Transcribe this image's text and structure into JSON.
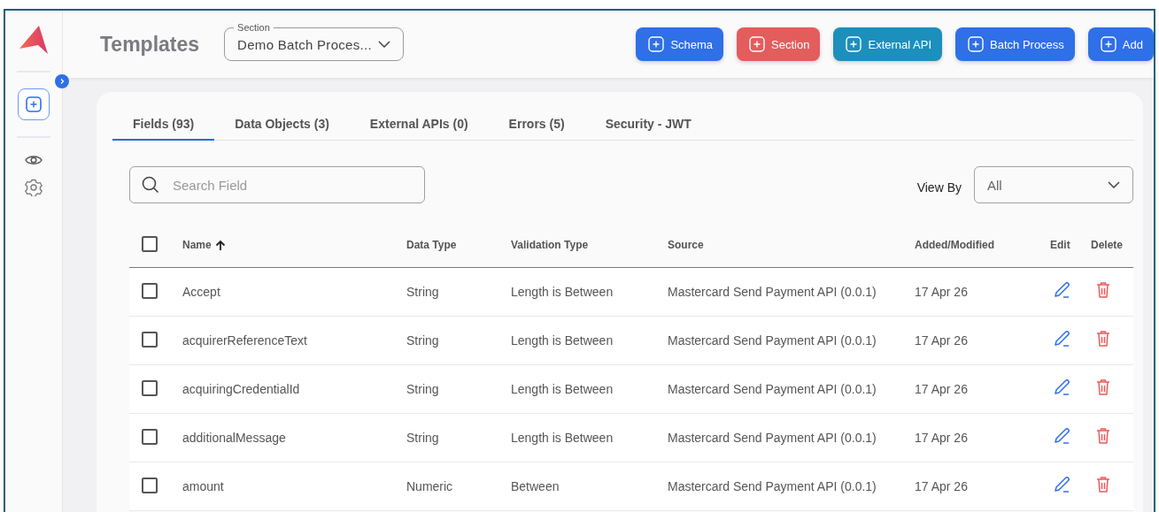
{
  "page": {
    "title": "Templates"
  },
  "section_select": {
    "label": "Section",
    "value": "Demo Batch Proces..."
  },
  "actions": [
    {
      "label": "Schema",
      "color": "#2f6fe8"
    },
    {
      "label": "Section",
      "color": "#e35d5d"
    },
    {
      "label": "External API",
      "color": "#1c8fbd"
    },
    {
      "label": "Batch Process",
      "color": "#2f6fe8"
    },
    {
      "label": "Add",
      "color": "#2f6fe8"
    }
  ],
  "tabs": [
    {
      "label": "Fields (93)",
      "selected": true
    },
    {
      "label": "Data Objects (3)",
      "selected": false
    },
    {
      "label": "External APIs (0)",
      "selected": false
    },
    {
      "label": "Errors (5)",
      "selected": false
    },
    {
      "label": "Security - JWT",
      "selected": false
    }
  ],
  "search": {
    "placeholder": "Search Field"
  },
  "view_by": {
    "label": "View By",
    "value": "All"
  },
  "table": {
    "select_all_checked": false,
    "columns": [
      "Name",
      "Data Type",
      "Validation Type",
      "Source",
      "Added/Modified",
      "Edit",
      "Delete"
    ],
    "rows": [
      {
        "checked": false,
        "cells": [
          "Accept",
          "String",
          "Length is Between",
          "Mastercard Send Payment API (0.0.1)",
          "17 Apr 26"
        ]
      },
      {
        "checked": false,
        "cells": [
          "acquirerReferenceText",
          "String",
          "Length is Between",
          "Mastercard Send Payment API (0.0.1)",
          "17 Apr 26"
        ]
      },
      {
        "checked": false,
        "cells": [
          "acquiringCredentialId",
          "String",
          "Length is Between",
          "Mastercard Send Payment API (0.0.1)",
          "17 Apr 26"
        ]
      },
      {
        "checked": false,
        "cells": [
          "additionalMessage",
          "String",
          "Length is Between",
          "Mastercard Send Payment API (0.0.1)",
          "17 Apr 26"
        ]
      },
      {
        "checked": false,
        "cells": [
          "amount",
          "Numeric",
          "Between",
          "Mastercard Send Payment API (0.0.1)",
          "17 Apr 26"
        ]
      }
    ]
  }
}
